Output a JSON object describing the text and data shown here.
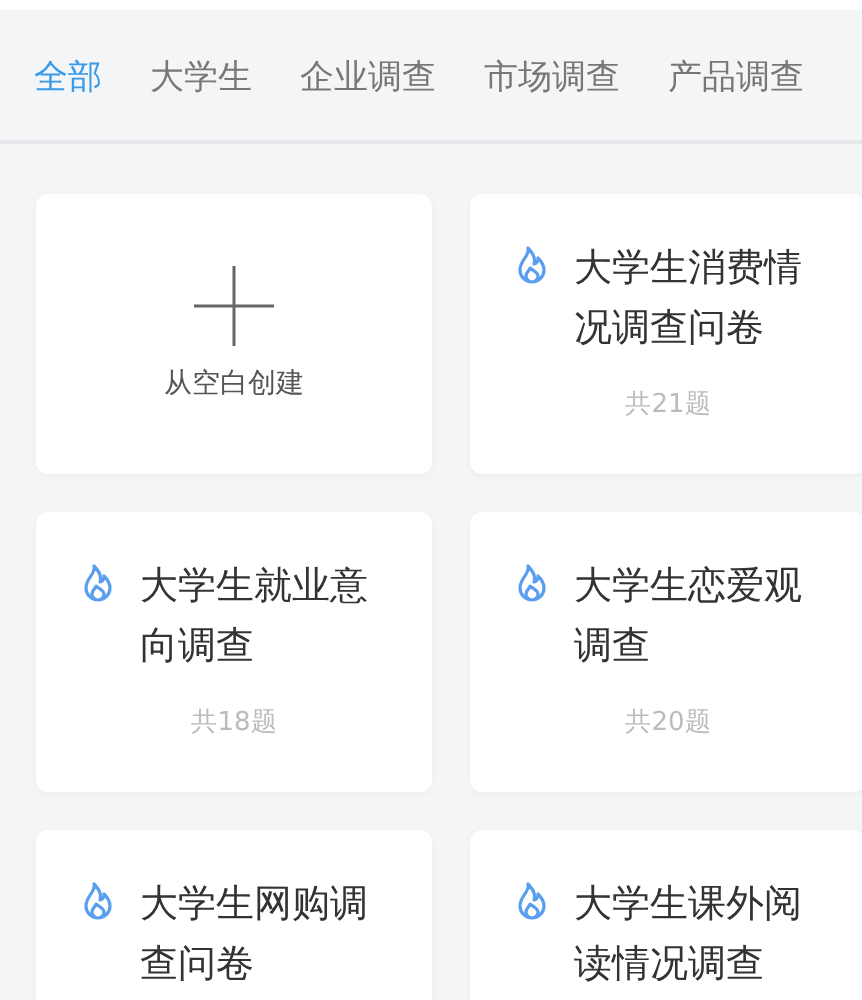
{
  "tabs": [
    {
      "label": "全部",
      "selected": true
    },
    {
      "label": "大学生",
      "selected": false
    },
    {
      "label": "企业调查",
      "selected": false
    },
    {
      "label": "市场调查",
      "selected": false
    },
    {
      "label": "产品调查",
      "selected": false
    }
  ],
  "cards": [
    {
      "kind": "create",
      "label": "从空白创建"
    },
    {
      "kind": "template",
      "title": "大学生消费情况调查问卷",
      "count": "共21题"
    },
    {
      "kind": "template",
      "title": "大学生就业意向调查",
      "count": "共18题"
    },
    {
      "kind": "template",
      "title": "大学生恋爱观调查",
      "count": "共20题"
    },
    {
      "kind": "template",
      "title": "大学生网购调查问卷"
    },
    {
      "kind": "template",
      "title": "大学生课外阅读情况调查"
    }
  ]
}
